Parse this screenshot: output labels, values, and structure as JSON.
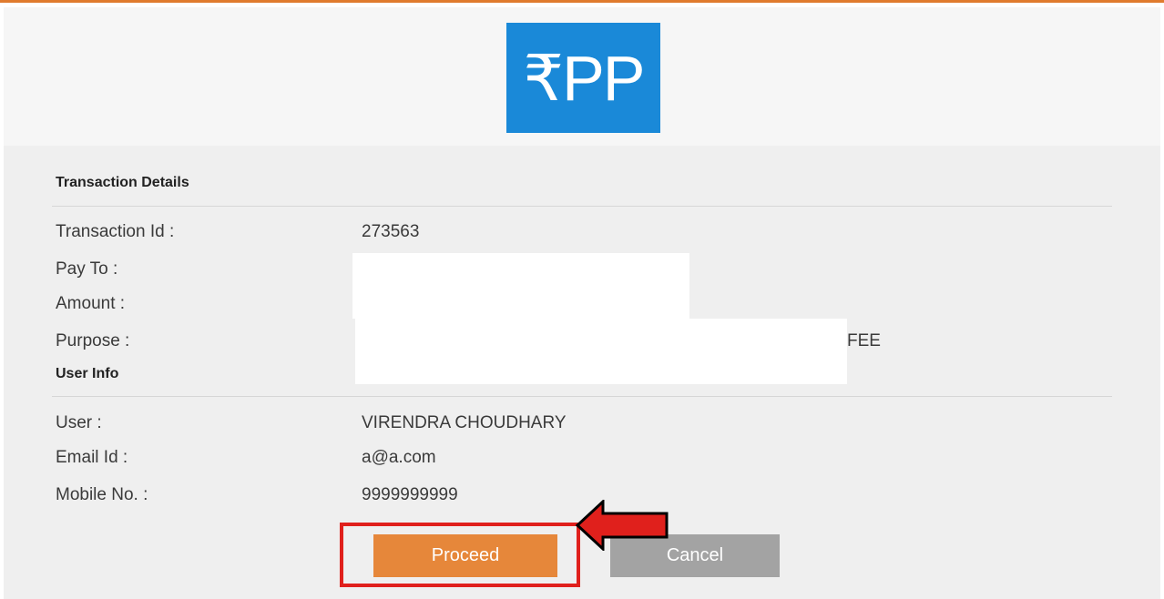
{
  "logo": {
    "text": "₹PP",
    "background_color": "#1a89d8"
  },
  "transaction_details": {
    "title": "Transaction Details",
    "rows": [
      {
        "label": "Transaction Id :",
        "value": "273563"
      },
      {
        "label": "Pay To :",
        "value": ""
      },
      {
        "label": "Amount :",
        "value": ""
      },
      {
        "label": "Purpose :",
        "value": "FEE",
        "value_partial": "; FEE"
      }
    ]
  },
  "user_info": {
    "title": "User Info",
    "rows": [
      {
        "label": "User :",
        "value": "VIRENDRA CHOUDHARY"
      },
      {
        "label": "Email Id :",
        "value": "a@a.com"
      },
      {
        "label": "Mobile No. :",
        "value": "9999999999"
      }
    ]
  },
  "buttons": {
    "proceed_label": "Proceed",
    "cancel_label": "Cancel"
  },
  "colors": {
    "accent": "#e6873a",
    "cancel": "#a3a3a3",
    "highlight": "#e0201c",
    "top_line": "#e07b2e"
  }
}
